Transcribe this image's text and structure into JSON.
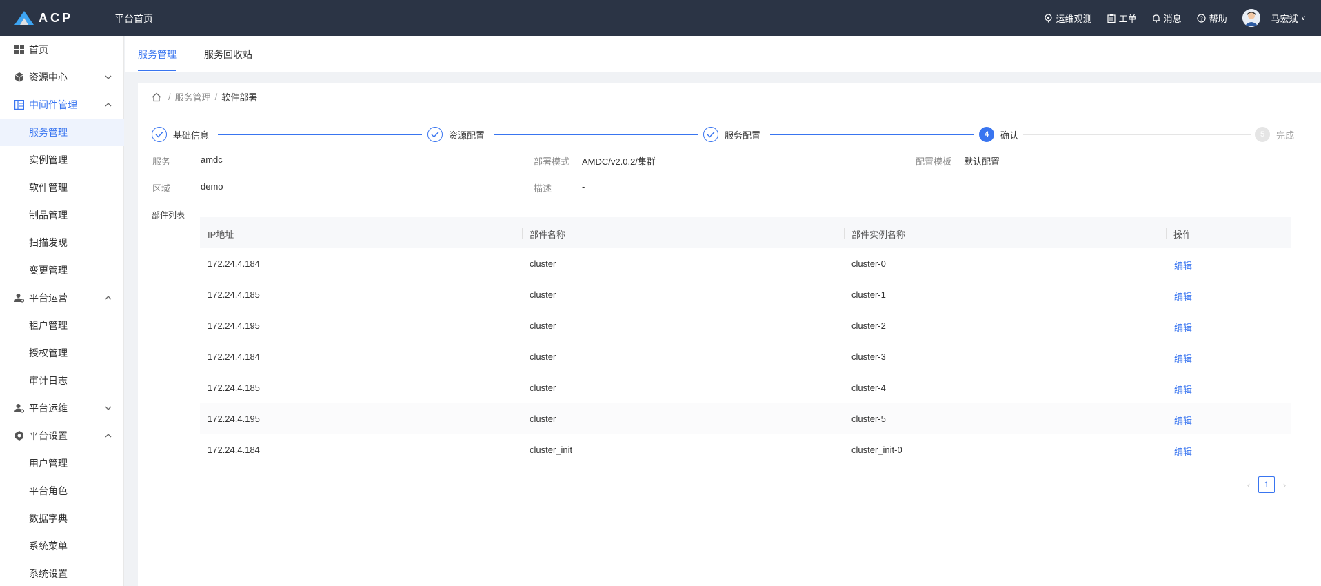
{
  "header": {
    "logo_text": "ACP",
    "home_label": "平台首页",
    "actions": [
      {
        "label": "运维观测",
        "icon": "monitor-icon"
      },
      {
        "label": "工单",
        "icon": "clipboard-icon"
      },
      {
        "label": "消息",
        "icon": "bell-icon"
      },
      {
        "label": "帮助",
        "icon": "help-circle-icon"
      }
    ],
    "user_name": "马宏斌",
    "user_caret": "∨"
  },
  "sidebar": {
    "items": [
      {
        "label": "首页",
        "icon": "grid-icon",
        "type": "top"
      },
      {
        "label": "资源中心",
        "icon": "cube-icon",
        "type": "group",
        "expanded": false
      },
      {
        "label": "中间件管理",
        "icon": "middleware-icon",
        "type": "group",
        "expanded": true
      },
      {
        "label": "服务管理",
        "type": "sub",
        "active": true
      },
      {
        "label": "实例管理",
        "type": "sub"
      },
      {
        "label": "软件管理",
        "type": "sub"
      },
      {
        "label": "制品管理",
        "type": "sub"
      },
      {
        "label": "扫描发现",
        "type": "sub"
      },
      {
        "label": "变更管理",
        "type": "sub"
      },
      {
        "label": "平台运营",
        "icon": "user-gear-icon",
        "type": "group",
        "expanded": true
      },
      {
        "label": "租户管理",
        "type": "sub"
      },
      {
        "label": "授权管理",
        "type": "sub"
      },
      {
        "label": "审计日志",
        "type": "sub"
      },
      {
        "label": "平台运维",
        "icon": "user-gear-icon",
        "type": "group",
        "expanded": false
      },
      {
        "label": "平台设置",
        "icon": "settings-icon",
        "type": "group",
        "expanded": true
      },
      {
        "label": "用户管理",
        "type": "sub"
      },
      {
        "label": "平台角色",
        "type": "sub"
      },
      {
        "label": "数据字典",
        "type": "sub"
      },
      {
        "label": "系统菜单",
        "type": "sub"
      },
      {
        "label": "系统设置",
        "type": "sub"
      }
    ]
  },
  "tabs": [
    {
      "label": "服务管理",
      "active": true
    },
    {
      "label": "服务回收站",
      "active": false
    }
  ],
  "breadcrumb": {
    "sep": "/",
    "items": [
      "服务管理",
      "软件部署"
    ]
  },
  "steps": [
    {
      "label": "基础信息",
      "status": "done"
    },
    {
      "label": "资源配置",
      "status": "done"
    },
    {
      "label": "服务配置",
      "status": "done"
    },
    {
      "label": "确认",
      "status": "active",
      "number": "4"
    },
    {
      "label": "完成",
      "status": "todo",
      "number": "5"
    }
  ],
  "info": {
    "service_label": "服务",
    "service_value": "amdc",
    "mode_label": "部署模式",
    "mode_value": "AMDC/v2.0.2/集群",
    "template_label": "配置模板",
    "template_value": "默认配置",
    "region_label": "区域",
    "region_value": "demo",
    "desc_label": "描述",
    "desc_value": "-",
    "list_label": "部件列表"
  },
  "table": {
    "columns": [
      "IP地址",
      "部件名称",
      "部件实例名称",
      "操作"
    ],
    "rows": [
      {
        "ip": "172.24.4.184",
        "name": "cluster",
        "instance": "cluster-0",
        "action": "编辑"
      },
      {
        "ip": "172.24.4.185",
        "name": "cluster",
        "instance": "cluster-1",
        "action": "编辑"
      },
      {
        "ip": "172.24.4.195",
        "name": "cluster",
        "instance": "cluster-2",
        "action": "编辑"
      },
      {
        "ip": "172.24.4.184",
        "name": "cluster",
        "instance": "cluster-3",
        "action": "编辑"
      },
      {
        "ip": "172.24.4.185",
        "name": "cluster",
        "instance": "cluster-4",
        "action": "编辑"
      },
      {
        "ip": "172.24.4.195",
        "name": "cluster",
        "instance": "cluster-5",
        "action": "编辑"
      },
      {
        "ip": "172.24.4.184",
        "name": "cluster_init",
        "instance": "cluster_init-0",
        "action": "编辑"
      }
    ]
  },
  "pagination": {
    "prev": "‹",
    "page": "1",
    "next": "›"
  },
  "colors": {
    "accent": "#3975f0",
    "topbar": "#2b3445"
  }
}
